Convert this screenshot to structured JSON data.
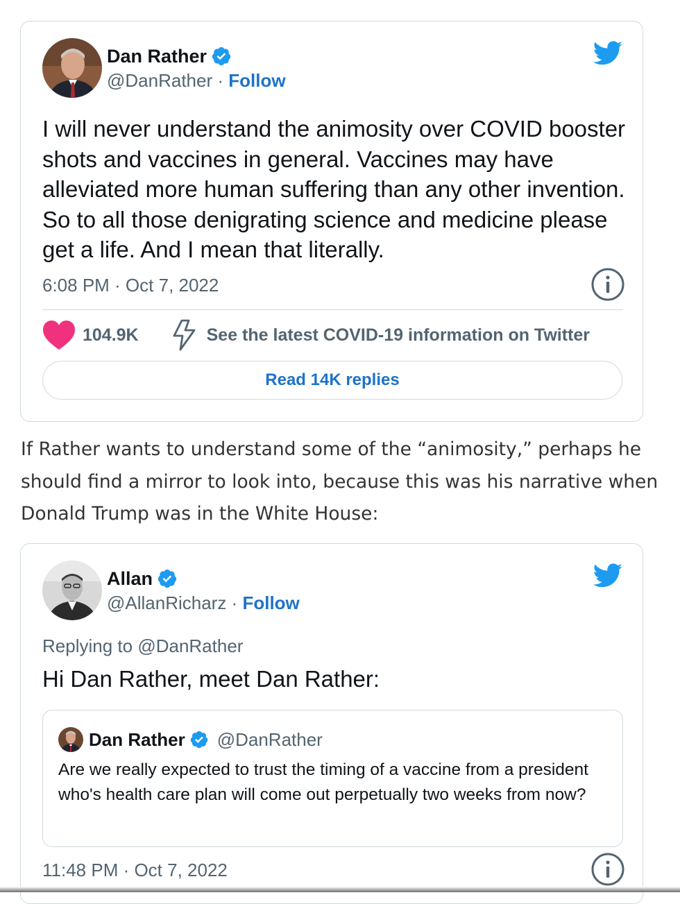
{
  "tweet1": {
    "name": "Dan Rather",
    "handle": "@DanRather",
    "separator": " · ",
    "follow": "Follow",
    "text": "I will never understand the animosity over COVID booster shots and vaccines in general. Vaccines may have alleviated more human suffering than any other invention. So to all those denigrating science and medicine please get a life. And I mean that literally.",
    "timestamp": "6:08 PM · Oct 7, 2022",
    "likes": "104.9K",
    "covid_info": "See the latest COVID-19 information on Twitter",
    "read_replies": "Read 14K replies"
  },
  "article": {
    "paragraph": "If Rather wants to understand some of the “animosity,” perhaps he should find a mirror to look into, because this was his narrative when Donald Trump was in the White House:"
  },
  "tweet2": {
    "name": "Allan",
    "handle": "@AllanRicharz",
    "separator": " · ",
    "follow": "Follow",
    "replying_prefix": "Replying to ",
    "replying_to": "@DanRather",
    "text": "Hi Dan Rather, meet Dan Rather:",
    "timestamp": "11:48 PM · Oct 7, 2022",
    "quote": {
      "name": "Dan Rather",
      "handle": "@DanRather",
      "text": "Are we really expected to trust the timing of a vaccine from a president who's health care plan will come out perpetually two weeks from now?"
    }
  },
  "colors": {
    "accent": "#1d9bf0",
    "link": "#1d73c9",
    "heart": "#f0317e",
    "muted": "#536471"
  },
  "icons": [
    "verified-badge-icon",
    "twitter-bird-icon",
    "info-icon",
    "heart-icon",
    "lightning-bolt-icon"
  ]
}
